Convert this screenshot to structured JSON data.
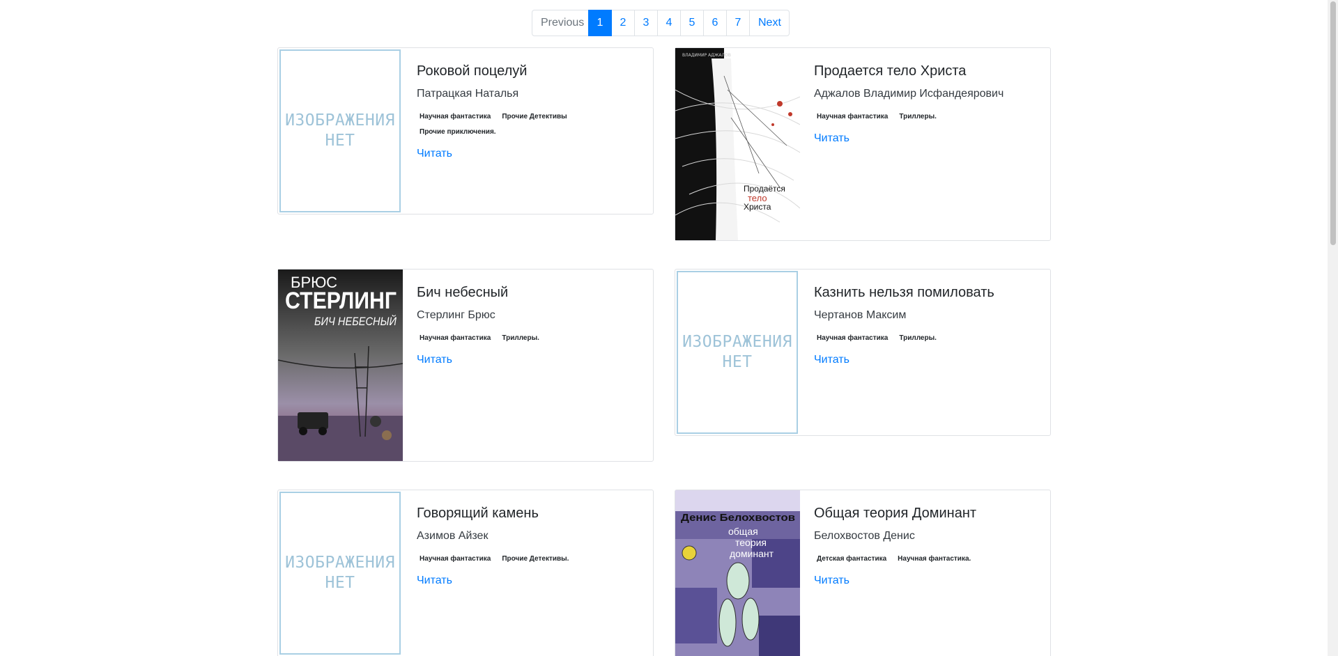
{
  "pagination": {
    "previous_label": "Previous",
    "pages": [
      "1",
      "2",
      "3",
      "4",
      "5",
      "6",
      "7"
    ],
    "active_page": "1",
    "next_label": "Next"
  },
  "placeholder_cover": {
    "line1": "ИЗОБРАЖЕНИЯ",
    "line2": "НЕТ"
  },
  "books": [
    {
      "title": "Роковой поцелуй",
      "author": "Патрацкая Наталья",
      "tags": [
        "Научная фантастика",
        "Прочие Детективы",
        "Прочие приключения."
      ],
      "read_label": "Читать"
    },
    {
      "title": "Продается тело Христа",
      "author": "Аджалов Владимир Исфандеярович",
      "tags": [
        "Научная фантастика",
        "Триллеры."
      ],
      "read_label": "Читать",
      "cover_text": {
        "top": "ВЛАДИМИР АДЖАЛОВ",
        "line1": "Продаётся",
        "line2": "тело",
        "line3": "Христа"
      }
    },
    {
      "title": "Бич небесный",
      "author": "Стерлинг Брюс",
      "tags": [
        "Научная фантастика",
        "Триллеры."
      ],
      "read_label": "Читать",
      "cover_text": {
        "line1": "БРЮС",
        "line2": "СТЕРЛИНГ",
        "line3": "БИЧ НЕБЕСНЫЙ"
      }
    },
    {
      "title": "Казнить нельзя помиловать",
      "author": "Чертанов Максим",
      "tags": [
        "Научная фантастика",
        "Триллеры."
      ],
      "read_label": "Читать"
    },
    {
      "title": "Говорящий камень",
      "author": "Азимов Айзек",
      "tags": [
        "Научная фантастика",
        "Прочие Детективы."
      ],
      "read_label": "Читать"
    },
    {
      "title": "Общая теория Доминант",
      "author": "Белохвостов Денис",
      "tags": [
        "Детская фантастика",
        "Научная фантастика."
      ],
      "read_label": "Читать",
      "cover_text": {
        "top": "Денис Белохвостов",
        "line1": "общая",
        "line2": "теория",
        "line3": "доминант"
      }
    }
  ],
  "colors": {
    "accent": "#007bff",
    "placeholder_text": "#9ec3d8",
    "placeholder_border": "#a9cfe4",
    "card_border": "#dfe1e5"
  }
}
